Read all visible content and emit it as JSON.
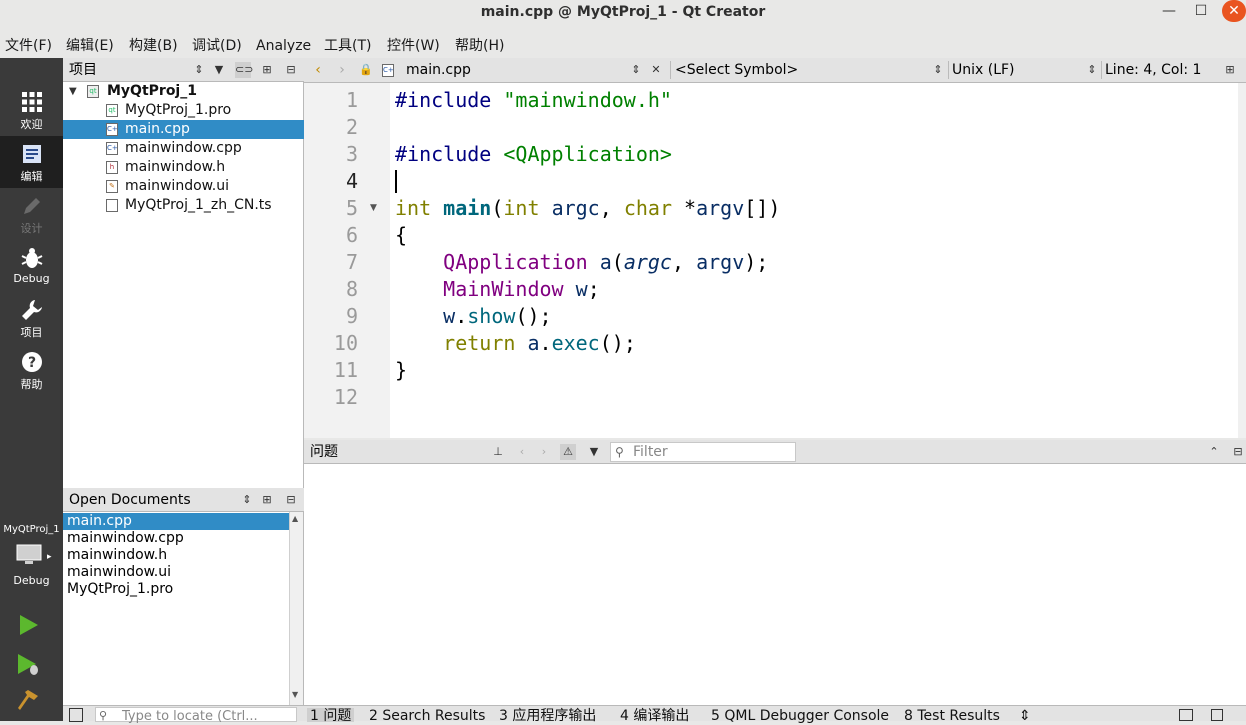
{
  "window": {
    "title": "main.cpp @ MyQtProj_1 - Qt Creator",
    "minimize": "—",
    "maximize": "☐",
    "close": "✕"
  },
  "menu": [
    "文件(F)",
    "编辑(E)",
    "构建(B)",
    "调试(D)",
    "Analyze",
    "工具(T)",
    "控件(W)",
    "帮助(H)"
  ],
  "modes": [
    {
      "label": "欢迎",
      "icon": "grid-icon"
    },
    {
      "label": "编辑",
      "icon": "document-icon"
    },
    {
      "label": "设计",
      "icon": "pencil-icon"
    },
    {
      "label": "Debug",
      "icon": "bug-icon"
    },
    {
      "label": "项目",
      "icon": "wrench-icon"
    },
    {
      "label": "帮助",
      "icon": "help-icon"
    }
  ],
  "target": {
    "project": "MyQtProj_1",
    "mode": "Debug"
  },
  "project_pane": {
    "title": "项目",
    "root": "MyQtProj_1",
    "files": [
      "MyQtProj_1.pro",
      "main.cpp",
      "mainwindow.cpp",
      "mainwindow.h",
      "mainwindow.ui",
      "MyQtProj_1_zh_CN.ts"
    ],
    "selected": "main.cpp"
  },
  "open_documents": {
    "title": "Open Documents",
    "items": [
      "main.cpp",
      "mainwindow.cpp",
      "mainwindow.h",
      "mainwindow.ui",
      "MyQtProj_1.pro"
    ],
    "selected": "main.cpp"
  },
  "editor": {
    "file": "main.cpp",
    "symbol": "<Select Symbol>",
    "line_endings": "Unix (LF)",
    "position": "Line: 4, Col: 1",
    "line_numbers": [
      "1",
      "2",
      "3",
      "4",
      "5",
      "6",
      "7",
      "8",
      "9",
      "10",
      "11",
      "12"
    ],
    "current_line": 4
  },
  "issues": {
    "title": "问题",
    "filter_placeholder": "Filter"
  },
  "locator": {
    "placeholder": "Type to locate (Ctrl..."
  },
  "output_tabs": [
    "1 问题",
    "2 Search Results",
    "3 应用程序输出",
    "4 编译输出",
    "5 QML Debugger Console",
    "8 Test Results"
  ]
}
